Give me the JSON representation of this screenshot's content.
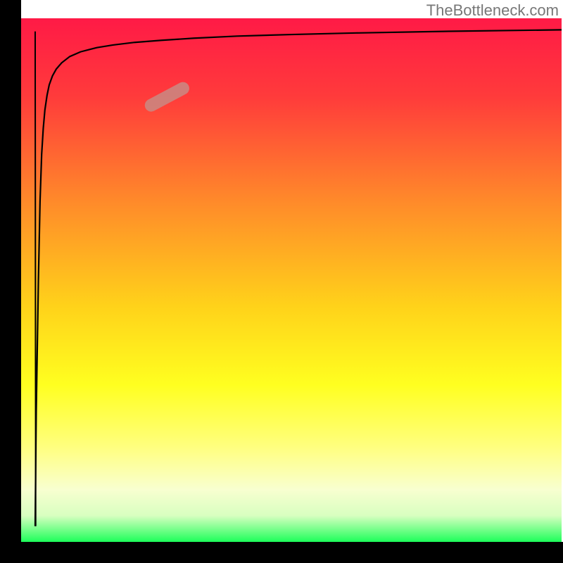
{
  "watermark": "TheBottleneck.com",
  "chart_data": {
    "type": "line",
    "title": "",
    "xlabel": "",
    "ylabel": "",
    "xlim": [
      0,
      100
    ],
    "ylim": [
      0,
      100
    ],
    "background_gradient": {
      "stops": [
        {
          "offset": 0,
          "color": "#ff1a46"
        },
        {
          "offset": 15,
          "color": "#ff3b3b"
        },
        {
          "offset": 35,
          "color": "#ff8a2a"
        },
        {
          "offset": 55,
          "color": "#ffd21a"
        },
        {
          "offset": 70,
          "color": "#ffff20"
        },
        {
          "offset": 82,
          "color": "#ffff80"
        },
        {
          "offset": 90,
          "color": "#f8ffd0"
        },
        {
          "offset": 95,
          "color": "#d8ffc0"
        },
        {
          "offset": 100,
          "color": "#1dff5a"
        }
      ]
    },
    "series": [
      {
        "name": "bottleneck-curve",
        "x": [
          2.6,
          3.0,
          3.5,
          4.0,
          4.5,
          5.0,
          6.0,
          7.0,
          8.0,
          9.0,
          10,
          12,
          15,
          18,
          22,
          27,
          33,
          40,
          48,
          58,
          70,
          85,
          100
        ],
        "y": [
          3,
          30,
          50,
          62,
          70,
          75,
          80,
          83.5,
          85.7,
          87.2,
          88.3,
          89.9,
          91.4,
          92.3,
          93.1,
          93.8,
          94.4,
          94.9,
          95.3,
          95.7,
          96.1,
          96.5,
          96.8
        ]
      },
      {
        "name": "dip-left",
        "x": [
          2.6,
          2.8,
          3.2,
          3.5,
          3.8,
          4.1,
          4.4,
          4.8,
          5.2,
          5.8,
          6.5,
          7.5,
          9.0,
          11,
          14,
          17,
          21,
          26,
          32,
          40,
          50,
          62,
          78,
          100
        ],
        "y": [
          3,
          25,
          50,
          65,
          74,
          79,
          82.5,
          85.3,
          87.3,
          89.0,
          90.3,
          91.5,
          92.7,
          93.6,
          94.4,
          94.9,
          95.4,
          95.8,
          96.2,
          96.6,
          96.9,
          97.2,
          97.5,
          97.8
        ]
      }
    ],
    "initial_spike": {
      "name": "left-spike",
      "x": [
        2.6,
        2.65,
        2.7
      ],
      "y": [
        97.5,
        50,
        3
      ]
    },
    "marker": {
      "name": "highlight-segment",
      "x_center": 27,
      "y_center": 85,
      "angle_deg": -28,
      "length": 9,
      "color": "#c98984",
      "opacity": 0.85
    }
  }
}
